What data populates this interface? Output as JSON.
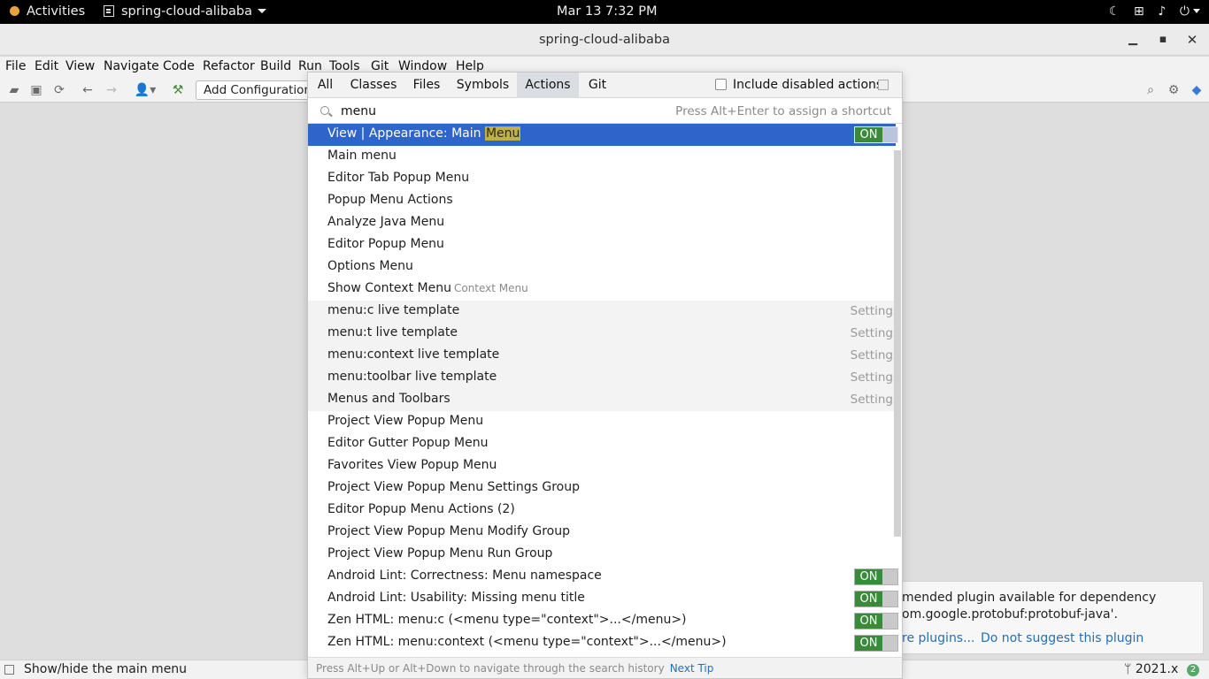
{
  "topbar": {
    "activities": "Activities",
    "app_menu": "spring-cloud-alibaba",
    "clock": "Mar 13  7:32 PM"
  },
  "window": {
    "title": "spring-cloud-alibaba",
    "minimize": "▁",
    "maximize": "▪",
    "close": "✕"
  },
  "menubar": [
    "File",
    "Edit",
    "View",
    "Navigate",
    "Code",
    "Refactor",
    "Build",
    "Run",
    "Tools",
    "Git",
    "Window",
    "Help"
  ],
  "toolbar": {
    "add_configuration": "Add Configuration..."
  },
  "popup": {
    "tabs": [
      "All",
      "Classes",
      "Files",
      "Symbols",
      "Actions",
      "Git"
    ],
    "active_tab": "Actions",
    "include_disabled_label": "Include disabled actions",
    "include_disabled_checked": false,
    "search_value": "menu",
    "search_hint": "Press Alt+Enter to assign a shortcut",
    "results": [
      {
        "label_prefix": "View | Appearance: Main ",
        "label_highlight": "Menu",
        "toggle": "ON",
        "selected": true
      },
      {
        "label": "Main menu"
      },
      {
        "label": "Editor Tab Popup Menu"
      },
      {
        "label": "Popup Menu Actions"
      },
      {
        "label": "Analyze Java Menu"
      },
      {
        "label": "Editor Popup Menu"
      },
      {
        "label": "Options Menu"
      },
      {
        "label": "Show Context Menu",
        "hint": "Context Menu"
      },
      {
        "label": "menu:c live template",
        "setting": "Settings"
      },
      {
        "label": "menu:t live template",
        "setting": "Settings"
      },
      {
        "label": "menu:context live template",
        "setting": "Settings"
      },
      {
        "label": "menu:toolbar live template",
        "setting": "Settings"
      },
      {
        "label": "Menus and Toolbars",
        "setting": "Settings"
      },
      {
        "label": "Project View Popup Menu"
      },
      {
        "label": "Editor Gutter Popup Menu"
      },
      {
        "label": "Favorites View Popup Menu"
      },
      {
        "label": "Project View Popup Menu Settings Group"
      },
      {
        "label": "Editor Popup Menu Actions (2)"
      },
      {
        "label": "Project View Popup Menu Modify Group"
      },
      {
        "label": "Project View Popup Menu Run Group"
      },
      {
        "label": "Android Lint: Correctness: Menu namespace",
        "toggle": "ON"
      },
      {
        "label": "Android Lint: Usability: Missing menu title",
        "toggle": "ON"
      },
      {
        "label": "Zen HTML: menu:c (<menu type=\"context\">...</menu>)",
        "toggle": "ON"
      },
      {
        "label": "Zen HTML: menu:context (<menu type=\"context\">...</menu>)",
        "toggle": "ON"
      }
    ],
    "footer_text": "Press Alt+Up or Alt+Down to navigate through the search history",
    "footer_link": "Next Tip"
  },
  "notification": {
    "line1": "mended plugin available for dependency",
    "line2": "om.google.protobuf:protobuf-java'.",
    "link1": "re plugins...",
    "link2": "Do not suggest this plugin"
  },
  "statusbar": {
    "text": "Show/hide the main menu",
    "branch": "2021.x",
    "badge": "2"
  },
  "colors": {
    "selection": "#2f65ca",
    "toggle_on": "#3a8a3a",
    "link": "#2470b3",
    "highlight": "#bfb04a"
  }
}
